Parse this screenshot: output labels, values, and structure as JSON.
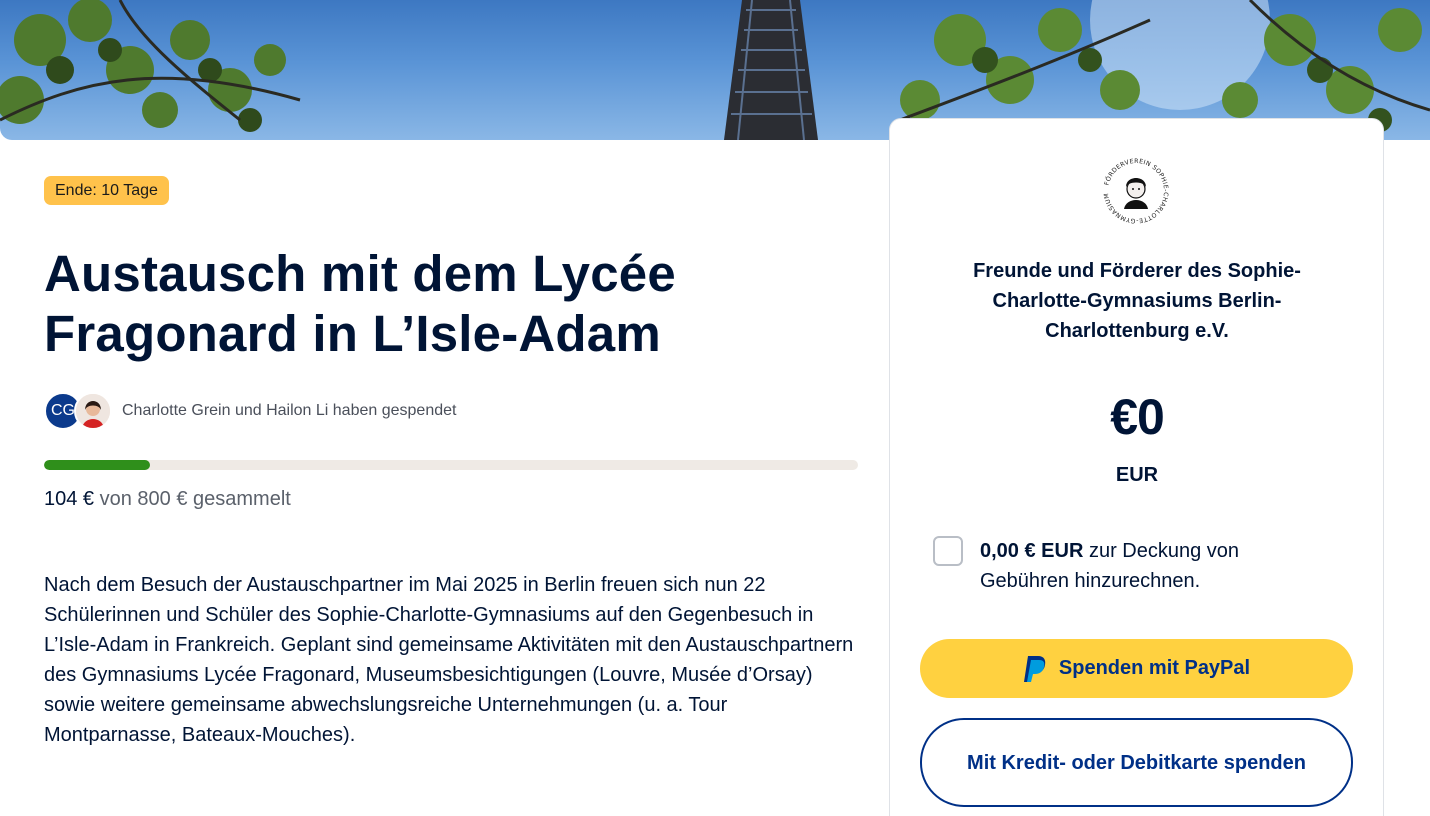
{
  "campaign": {
    "end_badge": "Ende: 10 Tage",
    "title": "Austausch mit dem Lycée Fragonard in L’Isle-Adam",
    "donors": {
      "initials": "CG",
      "text": "Charlotte Grein und Hailon Li haben gespendet"
    },
    "progress": {
      "fraction": 0.13,
      "raised": "104 €",
      "goal_text": " von 800 € gesammelt"
    },
    "description": "Nach dem Besuch der Austauschpartner im Mai 2025 in Berlin freuen sich nun 22 Schülerinnen und Schüler des Sophie-Charlotte-Gymnasiums auf den Gegenbesuch in L’Isle-Adam in Frankreich. Geplant sind gemeinsame Aktivitäten mit den Austauschpartnern des Gymnasiums Lycée Fragonard, Museumsbesichtigungen (Louvre, Musée d’Orsay) sowie weitere gemeinsame abwechslungsreiche Unternehmungen (u. a. Tour Montparnasse, Bateaux-Mouches)."
  },
  "donation_card": {
    "logo_text": "FÖRDERVEREIN SOPHIE-CHARLOTTE-GYMNASIUM",
    "organization": "Freunde und Förderer des Sophie-Charlotte-Gymnasiums Berlin-Charlottenburg e.V.",
    "amount": "€0",
    "currency": "EUR",
    "fee_amount": "0,00 € EUR",
    "fee_text": " zur Deckung von Gebühren hinzurechnen.",
    "paypal_button": "Spenden mit PayPal",
    "card_button": "Mit Kredit- oder Debitkarte spenden"
  },
  "colors": {
    "primary_text": "#001435",
    "badge": "#ffc24b",
    "progress": "#2f8f1b",
    "paypal_yellow": "#ffd140",
    "paypal_blue": "#003087"
  },
  "icons": [
    "paypal-icon",
    "checkbox-icon"
  ]
}
